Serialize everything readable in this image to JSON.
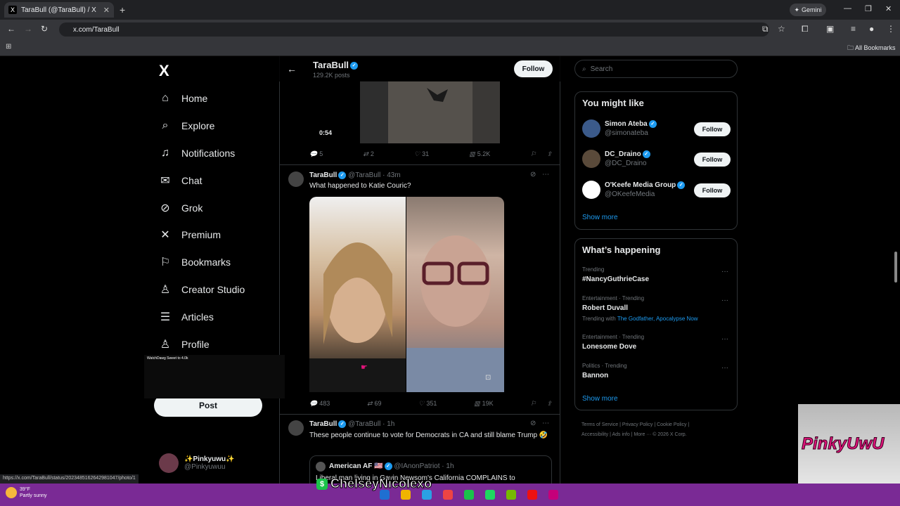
{
  "browser": {
    "tab_title": "TaraBull (@TaraBull) / X",
    "tab_favicon": "X",
    "tab_close": "✕",
    "new_tab": "+",
    "gemini": "Gemini",
    "url": "x.com/TaraBull",
    "all_bookmarks": "All Bookmarks",
    "status_url": "https://x.com/TaraBull/status/2023485162642981047/photo/1"
  },
  "nav": {
    "logo": "X",
    "items": [
      {
        "label": "Home",
        "icon": "home-icon",
        "glyph": "⌂"
      },
      {
        "label": "Explore",
        "icon": "search-icon",
        "glyph": "⌕"
      },
      {
        "label": "Notifications",
        "icon": "bell-icon",
        "glyph": "♫"
      },
      {
        "label": "Chat",
        "icon": "mail-icon",
        "glyph": "✉"
      },
      {
        "label": "Grok",
        "icon": "grok-icon",
        "glyph": "⊘"
      },
      {
        "label": "Premium",
        "icon": "x-premium-icon",
        "glyph": "✕"
      },
      {
        "label": "Bookmarks",
        "icon": "bookmark-icon",
        "glyph": "⚐"
      },
      {
        "label": "Creator Studio",
        "icon": "creator-icon",
        "glyph": "♙"
      },
      {
        "label": "Articles",
        "icon": "articles-icon",
        "glyph": "☰"
      },
      {
        "label": "Profile",
        "icon": "person-icon",
        "glyph": "♙"
      },
      {
        "label": "More",
        "icon": "more-icon",
        "glyph": "⋯"
      }
    ],
    "post_label": "Post",
    "account_name": "✨Pinkyuwu✨",
    "account_handle": "@Pinkyuwuu"
  },
  "profile_header": {
    "name": "TaraBull",
    "posts": "129.2K posts",
    "follow": "Follow"
  },
  "video": {
    "duration": "0:54"
  },
  "tweets": [
    {
      "actions": {
        "replies": "5",
        "reposts": "2",
        "likes": "31",
        "views": "5.2K"
      }
    },
    {
      "name": "TaraBull",
      "handle": "@TaraBull",
      "time": "43m",
      "text": "What happened to Katie Couric?",
      "actions": {
        "replies": "483",
        "reposts": "69",
        "likes": "351",
        "views": "19K"
      }
    },
    {
      "name": "TaraBull",
      "handle": "@TaraBull",
      "time": "1h",
      "text": "These people continue to vote for Democrats in CA and still blame Trump 🤣",
      "quote": {
        "name": "American AF 🇺🇸",
        "handle": "@IAnonPatriot",
        "time": "1h",
        "text": "Liberal man living in Gavin Newsom's California COMPLAINS to"
      }
    }
  ],
  "right": {
    "search_placeholder": "Search",
    "you_might_like": "You might like",
    "suggestions": [
      {
        "name": "Simon Ateba",
        "handle": "@simonateba",
        "follow": "Follow",
        "color": "#3b5a8a"
      },
      {
        "name": "DC_Draino",
        "handle": "@DC_Draino",
        "follow": "Follow",
        "color": "#5a4a3a"
      },
      {
        "name": "O'Keefe Media Group",
        "handle": "@OKeefeMedia",
        "follow": "Follow",
        "color": "#ffffff"
      }
    ],
    "show_more": "Show more",
    "whats_happening": "What’s happening",
    "trends": [
      {
        "category": "Trending",
        "name": "#NancyGuthrieCase",
        "with": ""
      },
      {
        "category": "Entertainment · Trending",
        "name": "Robert Duvall",
        "with_prefix": "Trending with ",
        "with": "The Godfather, Apocalypse Now"
      },
      {
        "category": "Entertainment · Trending",
        "name": "Lonesome Dove",
        "with": ""
      },
      {
        "category": "Politics · Trending",
        "name": "Bannon",
        "with": ""
      }
    ],
    "footer_line1": "Terms of Service  |  Privacy Policy  |  Cookie Policy  |",
    "footer_line2": "Accessibility  |  Ads info  |  More ···  © 2026 X Corp."
  },
  "overlays": {
    "streamer_name": "ChelseyNicolexo",
    "pinky_logo": "PinkyUwU",
    "scoreboard_title": "WatchDawg Sweet to 4.0k"
  },
  "taskbar": {
    "temperature": "39°F",
    "condition": "Partly sunny",
    "app_colors": [
      "#1f6fd1",
      "#f0b400",
      "#2aa1e3",
      "#e44",
      "#1ac34a",
      "#1ed760",
      "#76b900",
      "#e11",
      "#c5007a"
    ]
  }
}
